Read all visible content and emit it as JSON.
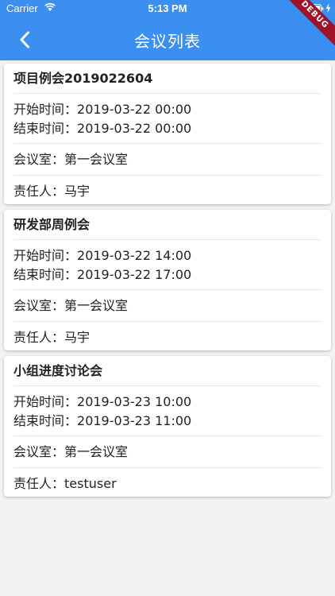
{
  "status_bar": {
    "carrier": "Carrier",
    "time": "5:13 PM"
  },
  "app_bar": {
    "title": "会议列表",
    "background": "#3a8ff0",
    "debug_label": "DEBUG"
  },
  "labels": {
    "start": "开始时间：",
    "end": "结束时间：",
    "room": "会议室：",
    "owner": "责任人："
  },
  "meetings": [
    {
      "title": "项目例会2019022604",
      "start": "2019-03-22 00:00",
      "end": "2019-03-22 00:00",
      "room": "第一会议室",
      "owner": "马宇"
    },
    {
      "title": "研发部周例会",
      "start": "2019-03-22 14:00",
      "end": "2019-03-22 17:00",
      "room": "第一会议室",
      "owner": "马宇"
    },
    {
      "title": "小组进度讨论会",
      "start": "2019-03-23 10:00",
      "end": "2019-03-23 11:00",
      "room": "第一会议室",
      "owner": "testuser"
    }
  ]
}
